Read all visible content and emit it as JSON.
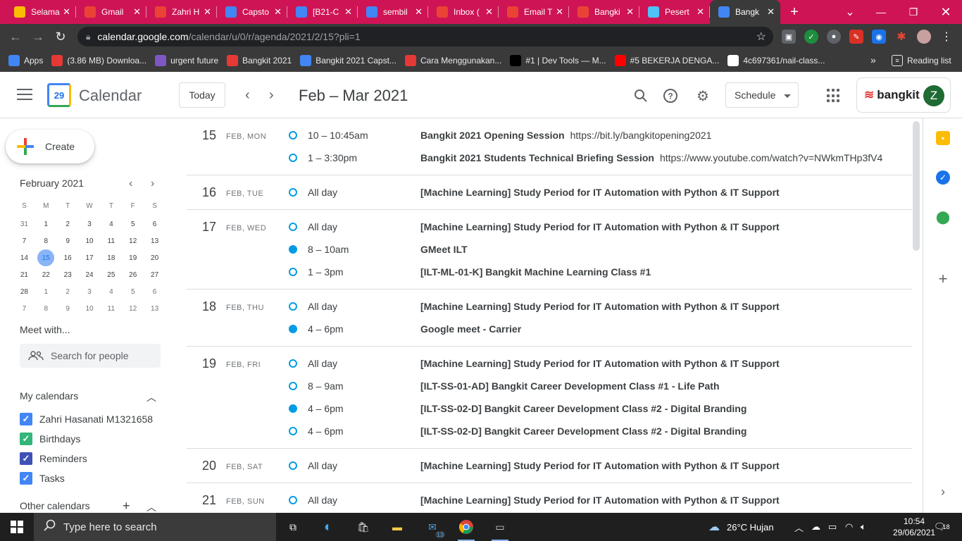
{
  "browser": {
    "tabs": [
      {
        "label": "Selama",
        "icon": "emoji-icon",
        "color": "#fbbc04"
      },
      {
        "label": "Gmail",
        "icon": "gmail-icon",
        "color": "#ea4335"
      },
      {
        "label": "Zahri H",
        "icon": "gmail-icon",
        "color": "#ea4335"
      },
      {
        "label": "Capsto",
        "icon": "docs-icon",
        "color": "#4285f4"
      },
      {
        "label": "[B21-C",
        "icon": "docs-icon",
        "color": "#4285f4"
      },
      {
        "label": "sembil",
        "icon": "google-icon",
        "color": "#4285f4"
      },
      {
        "label": "Inbox (",
        "icon": "gmail-icon",
        "color": "#ea4335"
      },
      {
        "label": "Email T",
        "icon": "gmail-icon",
        "color": "#ea4335"
      },
      {
        "label": "Bangki",
        "icon": "gmail-icon",
        "color": "#ea4335"
      },
      {
        "label": "Pesert",
        "icon": "cube-icon",
        "color": "#4fc3f7"
      },
      {
        "label": "Bangk",
        "icon": "calendar-icon",
        "color": "#4285f4"
      }
    ],
    "new_tab": "+",
    "url_host": "calendar.google.com",
    "url_path": "/calendar/u/0/r/agenda/2021/2/15?pli=1",
    "bookmarks": [
      {
        "label": "Apps",
        "icon": "apps-icon",
        "color": "#4285f4"
      },
      {
        "label": "(3.86 MB) Downloa...",
        "icon": "download-site-icon",
        "color": "#e53935"
      },
      {
        "label": "urgent future",
        "icon": "list-icon",
        "color": "#7e57c2"
      },
      {
        "label": "Bangkit 2021",
        "icon": "bangkit-icon",
        "color": "#e53935"
      },
      {
        "label": "Bangkit 2021 Capst...",
        "icon": "docs-icon",
        "color": "#4285f4"
      },
      {
        "label": "Cara Menggunakan...",
        "icon": "site-icon",
        "color": "#e53935"
      },
      {
        "label": "#1 | Dev Tools — M...",
        "icon": "medium-icon",
        "color": "#000000"
      },
      {
        "label": "#5 BEKERJA DENGA...",
        "icon": "youtube-icon",
        "color": "#ff0000"
      },
      {
        "label": "4c697361/nail-class...",
        "icon": "github-icon",
        "color": "#ffffff"
      }
    ],
    "more_bookmarks": "»",
    "reading_list": "Reading list"
  },
  "calendar": {
    "app_title": "Calendar",
    "logo_day": "29",
    "today_label": "Today",
    "date_range": "Feb – Mar 2021",
    "view_label": "Schedule",
    "brand": "bangkit",
    "avatar_initial": "Z",
    "create_label": "Create",
    "mini_month": "February 2021",
    "weekday_headers": [
      "S",
      "M",
      "T",
      "W",
      "T",
      "F",
      "S"
    ],
    "mini_weeks": [
      [
        "31",
        "1",
        "2",
        "3",
        "4",
        "5",
        "6"
      ],
      [
        "7",
        "8",
        "9",
        "10",
        "11",
        "12",
        "13"
      ],
      [
        "14",
        "15",
        "16",
        "17",
        "18",
        "19",
        "20"
      ],
      [
        "21",
        "22",
        "23",
        "24",
        "25",
        "26",
        "27"
      ],
      [
        "28",
        "1",
        "2",
        "3",
        "4",
        "5",
        "6"
      ],
      [
        "7",
        "8",
        "9",
        "10",
        "11",
        "12",
        "13"
      ]
    ],
    "selected_day": "15",
    "meet_with": "Meet with...",
    "search_people_placeholder": "Search for people",
    "my_calendars_label": "My calendars",
    "my_calendars": [
      {
        "name": "Zahri Hasanati M1321658",
        "color": "#4285f4"
      },
      {
        "name": "Birthdays",
        "color": "#33b679"
      },
      {
        "name": "Reminders",
        "color": "#3f51b5"
      },
      {
        "name": "Tasks",
        "color": "#4285f4"
      }
    ],
    "other_calendars_label": "Other calendars",
    "days": [
      {
        "num": "15",
        "name": "FEB, MON",
        "events": [
          {
            "time": "10 – 10:45am",
            "title": "Bangkit 2021 Opening Session",
            "location": "https://bit.ly/bangkitopening2021",
            "filled": false
          },
          {
            "time": "1 – 3:30pm",
            "title": "Bangkit 2021 Students Technical Briefing Session",
            "location": "https://www.youtube.com/watch?v=NWkmTHp3fV4",
            "filled": false
          }
        ]
      },
      {
        "num": "16",
        "name": "FEB, TUE",
        "events": [
          {
            "time": "All day",
            "title": "[Machine Learning] Study Period for IT Automation with Python & IT Support",
            "location": "",
            "filled": false
          }
        ]
      },
      {
        "num": "17",
        "name": "FEB, WED",
        "events": [
          {
            "time": "All day",
            "title": "[Machine Learning] Study Period for IT Automation with Python & IT Support",
            "location": "",
            "filled": false
          },
          {
            "time": "8 – 10am",
            "title": "GMeet ILT",
            "location": "",
            "filled": true
          },
          {
            "time": "1 – 3pm",
            "title": "[ILT-ML-01-K] Bangkit Machine Learning Class #1",
            "location": "",
            "filled": false
          }
        ]
      },
      {
        "num": "18",
        "name": "FEB, THU",
        "events": [
          {
            "time": "All day",
            "title": "[Machine Learning] Study Period for IT Automation with Python & IT Support",
            "location": "",
            "filled": false
          },
          {
            "time": "4 – 6pm",
            "title": "Google meet - Carrier",
            "location": "",
            "filled": true
          }
        ]
      },
      {
        "num": "19",
        "name": "FEB, FRI",
        "events": [
          {
            "time": "All day",
            "title": "[Machine Learning] Study Period for IT Automation with Python & IT Support",
            "location": "",
            "filled": false
          },
          {
            "time": "8 – 9am",
            "title": "[ILT-SS-01-AD] Bangkit Career Development Class #1 - Life Path",
            "location": "",
            "filled": false
          },
          {
            "time": "4 – 6pm",
            "title": "[ILT-SS-02-D] Bangkit Career Development Class #2 - Digital Branding",
            "location": "",
            "filled": true
          },
          {
            "time": "4 – 6pm",
            "title": "[ILT-SS-02-D] Bangkit Career Development Class #2 - Digital Branding",
            "location": "",
            "filled": false
          }
        ]
      },
      {
        "num": "20",
        "name": "FEB, SAT",
        "events": [
          {
            "time": "All day",
            "title": "[Machine Learning] Study Period for IT Automation with Python & IT Support",
            "location": "",
            "filled": false
          }
        ]
      },
      {
        "num": "21",
        "name": "FEB, SUN",
        "events": [
          {
            "time": "All day",
            "title": "[Machine Learning] Study Period for IT Automation with Python & IT Support",
            "location": "",
            "filled": false
          }
        ]
      }
    ]
  },
  "taskbar": {
    "search_placeholder": "Type here to search",
    "mail_badge": "13",
    "weather": "26°C  Hujan",
    "time": "10:54",
    "date": "29/06/2021",
    "notif_count": "18"
  }
}
